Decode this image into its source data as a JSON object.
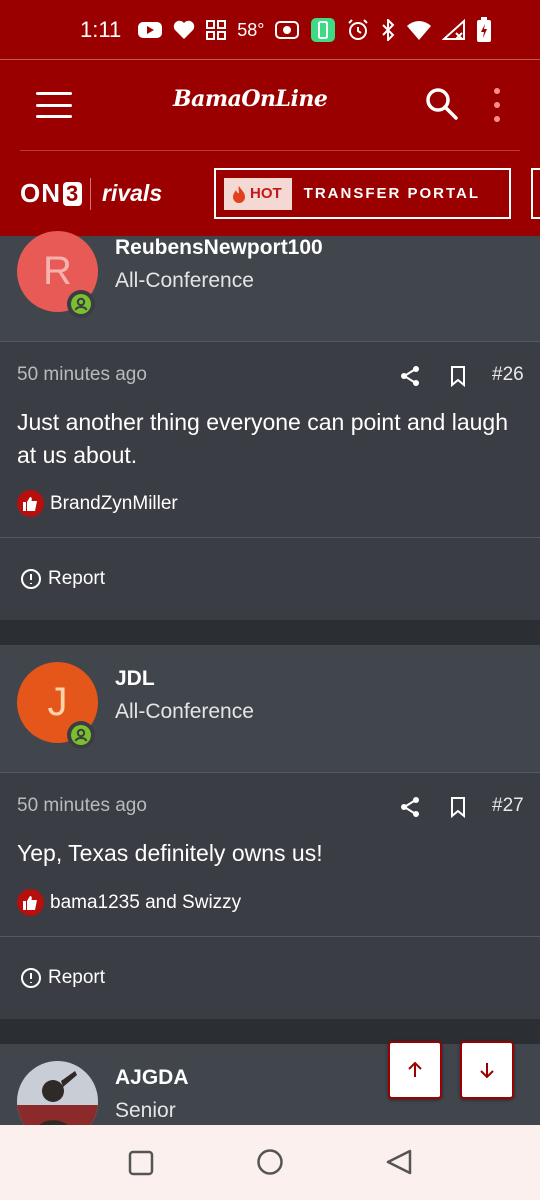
{
  "status_bar": {
    "time": "1:11",
    "temperature": "58°"
  },
  "header": {
    "logo": "BamaOnLine",
    "brand_on3": "ON",
    "brand_on3_digit": "3",
    "brand_rivals": "rivals",
    "hot_label": "HOT",
    "portal_label": "TRANSFER PORTAL"
  },
  "posts": [
    {
      "avatar_letter": "R",
      "avatar_color": "#e85a55",
      "username": "ReubensNewport100",
      "rank": "All-Conference",
      "time": "50 minutes ago",
      "number": "#26",
      "text": "Just another thing everyone can point and laugh at us about.",
      "likes": "BrandZynMiller",
      "report": "Report"
    },
    {
      "avatar_letter": "J",
      "avatar_color": "#e4561a",
      "username": "JDL",
      "rank": "All-Conference",
      "time": "50 minutes ago",
      "number": "#27",
      "text": "Yep, Texas definitely owns us!",
      "likes": "bama1235 and Swizzy",
      "report": "Report"
    },
    {
      "username": "AJGDA",
      "rank": "Senior"
    }
  ],
  "colors": {
    "brand": "#9b0000",
    "online": "#7bbf2e",
    "like": "#b70e0e"
  },
  "icons": [
    "menu-icon",
    "search-icon",
    "more-vert-icon",
    "flame-icon",
    "share-icon",
    "bookmark-icon",
    "like-icon",
    "alert-circle-icon",
    "arrow-up-icon",
    "arrow-down-icon"
  ]
}
